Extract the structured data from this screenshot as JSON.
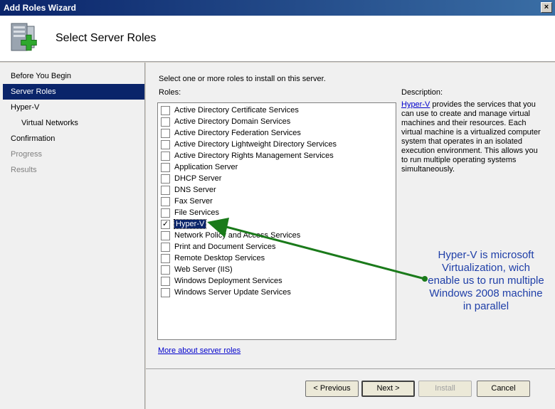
{
  "window": {
    "title": "Add Roles Wizard"
  },
  "header": {
    "title": "Select Server Roles",
    "icon": "server-add-icon"
  },
  "nav": {
    "items": [
      {
        "label": "Before You Begin",
        "state": "normal"
      },
      {
        "label": "Server Roles",
        "state": "active"
      },
      {
        "label": "Hyper-V",
        "state": "normal"
      },
      {
        "label": "Virtual Networks",
        "state": "normal",
        "sub": true
      },
      {
        "label": "Confirmation",
        "state": "normal"
      },
      {
        "label": "Progress",
        "state": "disabled"
      },
      {
        "label": "Results",
        "state": "disabled"
      }
    ]
  },
  "main": {
    "instruction": "Select one or more roles to install on this server.",
    "roles_label": "Roles:",
    "description_label": "Description:",
    "roles": [
      {
        "label": "Active Directory Certificate Services",
        "checked": false
      },
      {
        "label": "Active Directory Domain Services",
        "checked": false
      },
      {
        "label": "Active Directory Federation Services",
        "checked": false
      },
      {
        "label": "Active Directory Lightweight Directory Services",
        "checked": false
      },
      {
        "label": "Active Directory Rights Management Services",
        "checked": false
      },
      {
        "label": "Application Server",
        "checked": false
      },
      {
        "label": "DHCP Server",
        "checked": false
      },
      {
        "label": "DNS Server",
        "checked": false
      },
      {
        "label": "Fax Server",
        "checked": false
      },
      {
        "label": "File Services",
        "checked": false
      },
      {
        "label": "Hyper-V",
        "checked": true,
        "selected": true
      },
      {
        "label": "Network Policy and Access Services",
        "checked": false
      },
      {
        "label": "Print and Document Services",
        "checked": false
      },
      {
        "label": "Remote Desktop Services",
        "checked": false
      },
      {
        "label": "Web Server (IIS)",
        "checked": false
      },
      {
        "label": "Windows Deployment Services",
        "checked": false
      },
      {
        "label": "Windows Server Update Services",
        "checked": false
      }
    ],
    "description": {
      "link": "Hyper-V",
      "text": " provides the services that you can use to create and manage virtual machines and their resources. Each virtual machine is a virtualized computer system that operates in an isolated execution environment. This allows you to run multiple operating systems simultaneously."
    },
    "more_link": "More about server roles"
  },
  "footer": {
    "previous": "< Previous",
    "next": "Next >",
    "install": "Install",
    "cancel": "Cancel"
  },
  "annotation": {
    "text": "Hyper-V is microsoft Virtualization, wich enable us to run multiple Windows 2008 machine in parallel",
    "color": "#1f3fa8",
    "arrow_color": "#1a7a1a"
  }
}
